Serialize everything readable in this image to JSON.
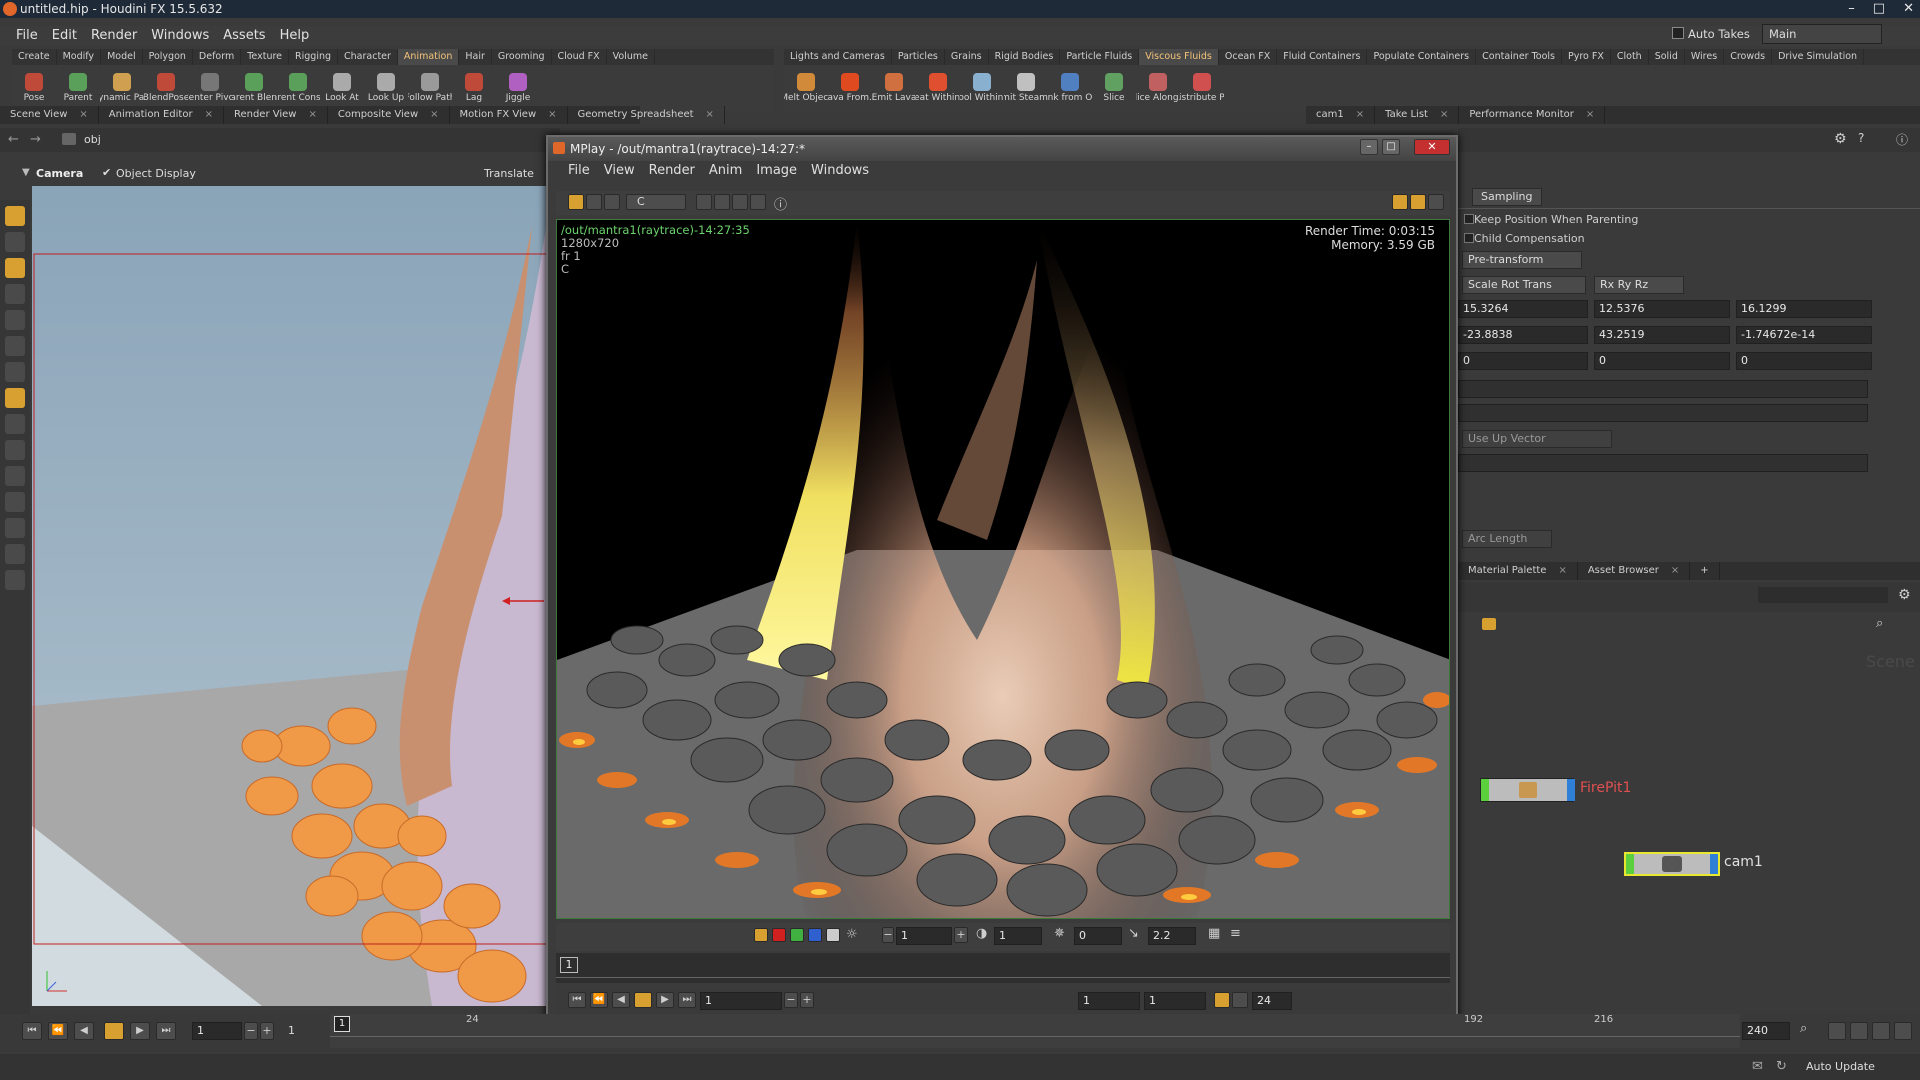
{
  "window": {
    "title": "untitled.hip - Houdini FX 15.5.632",
    "controls": [
      "–",
      "□",
      "✕"
    ]
  },
  "menu": [
    "File",
    "Edit",
    "Render",
    "Windows",
    "Assets",
    "Help"
  ],
  "auto_takes": "Auto Takes",
  "desktop": "Main",
  "shelf_tabs_left": [
    "Create",
    "Modify",
    "Model",
    "Polygon",
    "Deform",
    "Texture",
    "Rigging",
    "Character",
    "Animation",
    "Hair",
    "Grooming",
    "Cloud FX",
    "Volume"
  ],
  "shelf_tabs_right": [
    "Lights and Cameras",
    "Particles",
    "Grains",
    "Rigid Bodies",
    "Particle Fluids",
    "Viscous Fluids",
    "Ocean FX",
    "Fluid Containers",
    "Populate Containers",
    "Container Tools",
    "Pyro FX",
    "Cloth",
    "Solid",
    "Wires",
    "Crowds",
    "Drive Simulation"
  ],
  "tools_left": [
    {
      "label": "Pose",
      "color": "#c04a3a"
    },
    {
      "label": "Parent",
      "color": "#5aa05a"
    },
    {
      "label": "Dynamic Pa...",
      "color": "#d0a050"
    },
    {
      "label": "BlendPose",
      "color": "#c04a3a"
    },
    {
      "label": "Center Pivot",
      "color": "#777777"
    },
    {
      "label": "Parent Blend",
      "color": "#5aa05a"
    },
    {
      "label": "Parent Cons...",
      "color": "#5aa05a"
    },
    {
      "label": "Look At",
      "color": "#aaaaaa"
    },
    {
      "label": "Look Up",
      "color": "#aaaaaa"
    },
    {
      "label": "Follow Path",
      "color": "#9a9a9a"
    },
    {
      "label": "Lag",
      "color": "#c04a3a"
    },
    {
      "label": "Jiggle",
      "color": "#b060c0"
    }
  ],
  "tools_right": [
    {
      "label": "Melt Object",
      "color": "#d08a3a"
    },
    {
      "label": "Lava From...",
      "color": "#e04a20"
    },
    {
      "label": "Emit Lava",
      "color": "#d07040"
    },
    {
      "label": "Heat Within...",
      "color": "#e05030"
    },
    {
      "label": "Cool Within...",
      "color": "#8ab0d0"
    },
    {
      "label": "Emit Steam...",
      "color": "#c0c0c0"
    },
    {
      "label": "Sink from O...",
      "color": "#5080c0"
    },
    {
      "label": "Slice",
      "color": "#60a060"
    },
    {
      "label": "Slice Along...",
      "color": "#c06060"
    },
    {
      "label": "Distribute P...",
      "color": "#d05050"
    }
  ],
  "pane_tabs_left": [
    "Scene View",
    "Animation Editor",
    "Render View",
    "Composite View",
    "Motion FX View",
    "Geometry Spreadsheet"
  ],
  "pane_tabs_right": [
    "cam1",
    "Take List",
    "Performance Monitor"
  ],
  "path": "obj",
  "viewport": {
    "camera": "Camera",
    "object_display": "Object Display",
    "translate": "Translate"
  },
  "mplay": {
    "title": "MPlay - /out/mantra1(raytrace)-14:27:*",
    "menu": [
      "File",
      "View",
      "Render",
      "Anim",
      "Image",
      "Windows"
    ],
    "channel": "C",
    "info_name": "/out/mantra1(raytrace)-14:27:35",
    "info_res": "1280x720",
    "info_frame": "fr 1",
    "info_channel": "C",
    "render_time_label": "Render Time:",
    "render_time": "0:03:15",
    "memory_label": "Memory:",
    "memory": "3.59 GB",
    "controls": {
      "frame": "1",
      "exposure": "1",
      "offset": "0",
      "gamma": "2.2"
    },
    "marker": "1",
    "playback": {
      "frame": "1",
      "start": "1",
      "end": "1",
      "fps": "24"
    }
  },
  "params": {
    "tab": "Sampling",
    "keep_position": "Keep Position When Parenting",
    "child_comp": "Child Compensation",
    "pretransform": "Pre-transform",
    "xform_order": "Scale Rot Trans",
    "rot_order": "Rx Ry Rz",
    "translate": [
      "15.3264",
      "12.5376",
      "16.1299"
    ],
    "rotate": [
      "-23.8838",
      "43.2519",
      "-1.74672e-14"
    ],
    "scale": [
      "0",
      "0",
      "0"
    ],
    "up_vector": "Use Up Vector",
    "arc_length": "Arc Length"
  },
  "net_tabs": [
    "Material Palette",
    "Asset Browser"
  ],
  "scene_label": "Scene",
  "nodes": [
    {
      "name": "FirePit1",
      "color": "#e05050"
    },
    {
      "name": "cam1",
      "color": "#e0e0e0"
    }
  ],
  "timeline": {
    "frame": "1",
    "start": "1",
    "ticks": [
      "24",
      "192",
      "216"
    ],
    "end": "240",
    "marker": "1"
  },
  "status": {
    "auto_update": "Auto Update"
  }
}
